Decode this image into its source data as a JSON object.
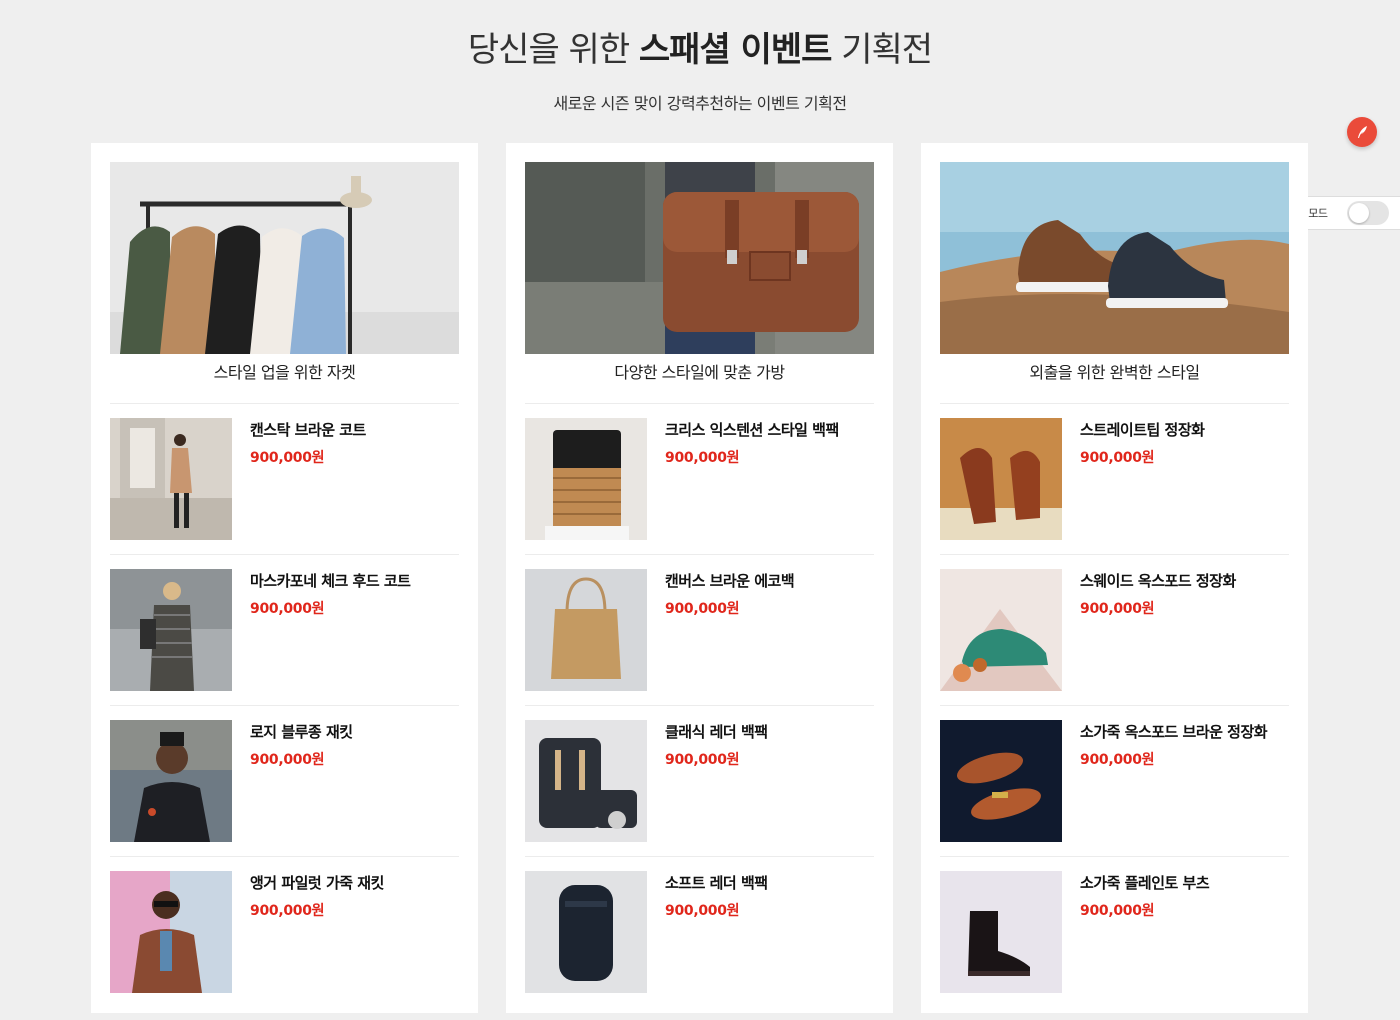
{
  "header": {
    "title_prefix": "당신을 위한 ",
    "title_bold": "스패셜 이벤트",
    "title_suffix": " 기획전",
    "subtitle": "새로운 시즌 맞이 강력추천하는 이벤트 기획전"
  },
  "edit_mode": {
    "label": "편집모드",
    "enabled": false
  },
  "fab": {
    "icon": "feather-icon",
    "color": "#ea4b3a"
  },
  "accent_price_color": "#e0261b",
  "columns": [
    {
      "title": "스타일 업을 위한 자켓",
      "hero_icon": "clothing-rack-image",
      "items": [
        {
          "name": "캔스탁 브라운 코트",
          "price": "900,000원"
        },
        {
          "name": "마스카포네 체크 후드 코트",
          "price": "900,000원"
        },
        {
          "name": "로지 블루종 재킷",
          "price": "900,000원"
        },
        {
          "name": "앵거 파일럿 가죽 재킷",
          "price": "900,000원"
        }
      ]
    },
    {
      "title": "다양한 스타일에 맞춘 가방",
      "hero_icon": "leather-satchel-image",
      "items": [
        {
          "name": "크리스 익스텐션 스타일 백팩",
          "price": "900,000원"
        },
        {
          "name": "캔버스 브라운 에코백",
          "price": "900,000원"
        },
        {
          "name": "클래식 레더 백팩",
          "price": "900,000원"
        },
        {
          "name": "소프트 레더 백팩",
          "price": "900,000원"
        }
      ]
    },
    {
      "title": "외출을 위한 완벽한 스타일",
      "hero_icon": "sneakers-image",
      "items": [
        {
          "name": "스트레이트팁 정장화",
          "price": "900,000원"
        },
        {
          "name": "스웨이드 옥스포드 정장화",
          "price": "900,000원"
        },
        {
          "name": "소가죽 옥스포드 브라운 정장화",
          "price": "900,000원"
        },
        {
          "name": "소가죽 플레인토 부츠",
          "price": "900,000원"
        }
      ]
    }
  ]
}
